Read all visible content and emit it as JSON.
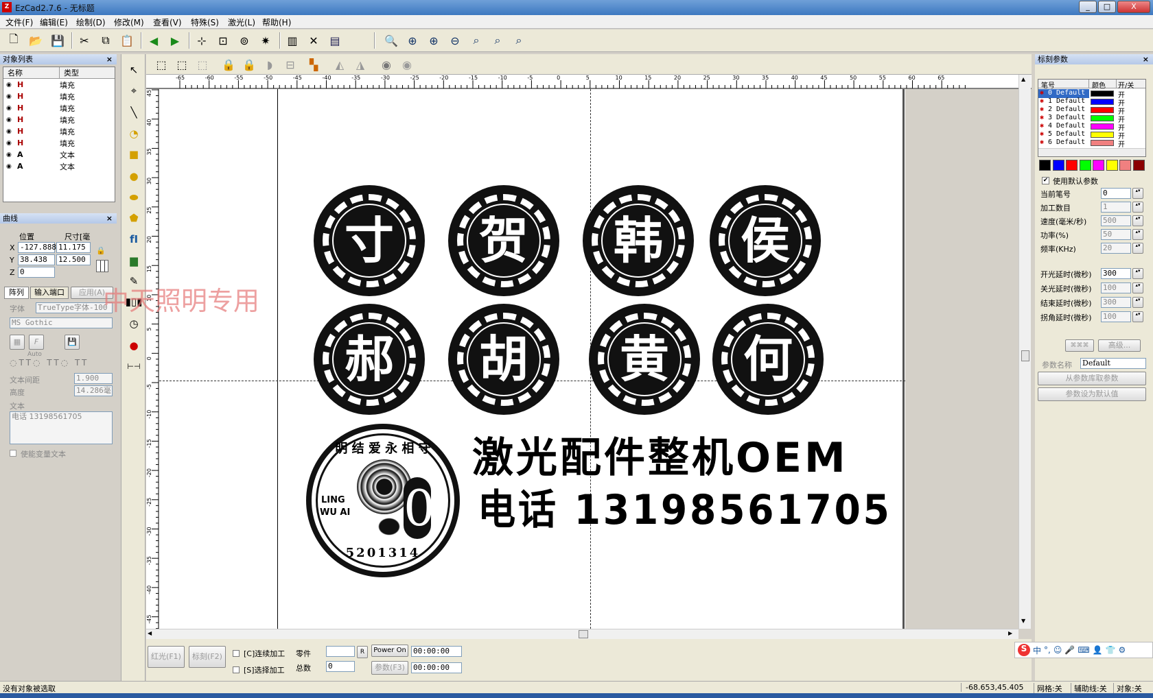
{
  "window": {
    "title": "EzCad2.7.6 - 无标题",
    "controls": [
      "_",
      "□",
      "X"
    ]
  },
  "menu": [
    "文件(F)",
    "编辑(E)",
    "绘制(D)",
    "修改(M)",
    "查看(V)",
    "特殊(S)",
    "激光(L)",
    "帮助(H)"
  ],
  "object_list": {
    "title": "对象列表",
    "columns": [
      "名称",
      "类型"
    ],
    "rows": [
      {
        "icon": "H",
        "type": "填充"
      },
      {
        "icon": "H",
        "type": "填充"
      },
      {
        "icon": "H",
        "type": "填充"
      },
      {
        "icon": "H",
        "type": "填充"
      },
      {
        "icon": "H",
        "type": "填充"
      },
      {
        "icon": "H",
        "type": "填充"
      },
      {
        "icon": "A",
        "type": "文本"
      },
      {
        "icon": "A",
        "type": "文本"
      }
    ]
  },
  "curve": {
    "title": "曲线",
    "pos_label": "位置",
    "size_label": "尺寸[毫",
    "x_label": "X",
    "y_label": "Y",
    "z_label": "Z",
    "x_pos": "-127.888",
    "x_size": "11.175",
    "y_pos": "38.438",
    "y_size": "12.500",
    "z_pos": "0"
  },
  "text_props": {
    "tabs": [
      "阵列",
      "输入端口",
      "应用(A)"
    ],
    "font_label": "字体",
    "font_type": "TrueType字体-100",
    "font_name": "MS Gothic",
    "auto_label": "Auto",
    "spacing_label": "文本间距",
    "spacing": "1.900",
    "height_label": "高度",
    "height": "14.286毫",
    "text_label": "文本",
    "text_value": "电话 13198561705",
    "variable_label": "使能变量文本"
  },
  "watermark": "中天照明专用",
  "ruler": {
    "h_ticks": [
      "-65",
      "-60",
      "-55",
      "-50",
      "-45",
      "-40",
      "-35",
      "-30",
      "-25",
      "-20",
      "-15",
      "-10",
      "-5",
      "0",
      "5",
      "10",
      "15",
      "20",
      "25",
      "30",
      "35",
      "40",
      "45",
      "50",
      "55",
      "60",
      "65"
    ],
    "v_ticks": [
      "45",
      "40",
      "35",
      "30",
      "25",
      "20",
      "15",
      "10",
      "5",
      "0",
      "-5",
      "-10",
      "-15",
      "-20",
      "-25",
      "-30",
      "-35",
      "-40",
      "-45"
    ]
  },
  "canvas": {
    "seals_row1": [
      "寸",
      "贺",
      "韩",
      "侯"
    ],
    "seals_row2": [
      "郝",
      "胡",
      "黄",
      "何"
    ],
    "coin": {
      "top_text": "明 结 爱 永 相 守",
      "left_text": "LING",
      "left_text2": "WU AI",
      "bottom_text": "5201314",
      "digit": "0"
    },
    "headline": "激光配件整机OEM",
    "phone": "电话  13198561705"
  },
  "bottom": {
    "red_button": "红光(F1)",
    "mark_button": "标刻(F2)",
    "continuous": "[C]连续加工",
    "select": "[S]选择加工",
    "parts_label": "零件",
    "total_label": "总数",
    "parts_value": "",
    "total_value": "0",
    "r_button": "R",
    "power": "Power On",
    "param_button": "参数(F3)",
    "time1": "00:00:00",
    "time2": "00:00:00"
  },
  "mark_params": {
    "title": "标刻参数",
    "columns": [
      "笔号",
      "颜色",
      "开/关"
    ],
    "pens": [
      {
        "label": "0 Default",
        "color": "#000000",
        "on": "开"
      },
      {
        "label": "1 Default",
        "color": "#0000ff",
        "on": "开"
      },
      {
        "label": "2 Default",
        "color": "#ff0000",
        "on": "开"
      },
      {
        "label": "3 Default",
        "color": "#00ff00",
        "on": "开"
      },
      {
        "label": "4 Default",
        "color": "#ff00ff",
        "on": "开"
      },
      {
        "label": "5 Default",
        "color": "#ffff00",
        "on": "开"
      },
      {
        "label": "6 Default",
        "color": "#f08080",
        "on": "开"
      }
    ],
    "palette": [
      "#000000",
      "#0000ff",
      "#ff0000",
      "#00ff00",
      "#ff00ff",
      "#ffff00",
      "#f08080",
      "#8b0000"
    ],
    "use_default": "使用默认参数",
    "fields": [
      {
        "label": "当前笔号",
        "value": "0"
      },
      {
        "label": "加工数目",
        "value": "1"
      },
      {
        "label": "速度(毫米/秒)",
        "value": "500"
      },
      {
        "label": "功率(%)",
        "value": "50"
      },
      {
        "label": "频率(KHz)",
        "value": "20"
      }
    ],
    "delays": [
      {
        "label": "开光延时(微秒)",
        "value": "300"
      },
      {
        "label": "关光延时(微秒)",
        "value": "100"
      },
      {
        "label": "结束延时(微秒)",
        "value": "300"
      },
      {
        "label": "拐角延时(微秒)",
        "value": "100"
      }
    ],
    "adv_a": "⌘⌘⌘",
    "adv_b": "高级...",
    "param_name_label": "参数名称",
    "param_name": "Default",
    "from_lib": "从参数库取参数",
    "set_default": "参数设为默认值"
  },
  "status": {
    "left": "没有对象被选取",
    "coords": "-68.653,45.405",
    "grid": "网格:关",
    "guide": "辅助线:关",
    "object": "对象:关"
  },
  "ime": [
    "S",
    "中",
    "°,",
    "☺",
    "🎤",
    "⌨",
    "👤",
    "👕",
    "⚙"
  ]
}
